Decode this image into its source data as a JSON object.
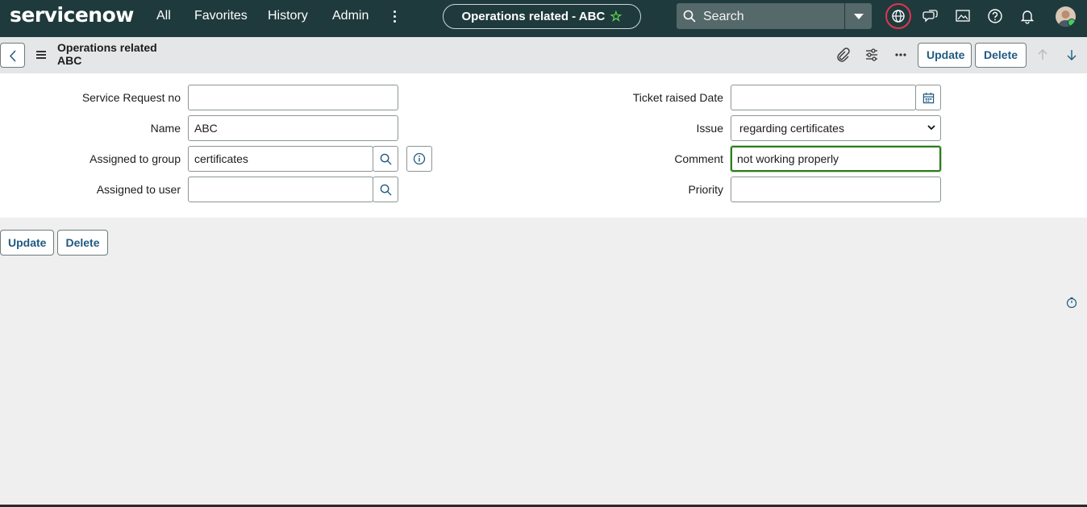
{
  "nav": {
    "logo": "servicenow",
    "links": [
      "All",
      "Favorites",
      "History",
      "Admin"
    ],
    "record_pill": "Operations related - ABC",
    "search_placeholder": "Search"
  },
  "header": {
    "title_line1": "Operations related",
    "title_line2": "ABC",
    "update_label": "Update",
    "delete_label": "Delete"
  },
  "form": {
    "service_request_no": {
      "label": "Service Request no",
      "value": ""
    },
    "name": {
      "label": "Name",
      "value": "ABC"
    },
    "assigned_to_group": {
      "label": "Assigned to group",
      "value": "certificates"
    },
    "assigned_to_user": {
      "label": "Assigned to user",
      "value": ""
    },
    "ticket_raised_date": {
      "label": "Ticket raised Date",
      "value": ""
    },
    "issue": {
      "label": "Issue",
      "value": "regarding certificates"
    },
    "comment": {
      "label": "Comment",
      "value": "not working properly"
    },
    "priority": {
      "label": "Priority",
      "value": ""
    }
  },
  "footer": {
    "update_label": "Update",
    "delete_label": "Delete"
  },
  "colors": {
    "nav_bg": "#1f3a3d",
    "accent_button_text": "#1f5a80",
    "focus_border": "#2e7a1f",
    "star": "#62d84e",
    "globe_ring": "#e1354e"
  },
  "icons": [
    "search-icon",
    "globe-icon",
    "chat-icon",
    "picture-icon",
    "help-icon",
    "bell-icon",
    "attachment-icon",
    "settings-sliders-icon",
    "more-icon",
    "arrow-up-icon",
    "arrow-down-icon",
    "calendar-icon",
    "info-icon",
    "timer-icon"
  ]
}
